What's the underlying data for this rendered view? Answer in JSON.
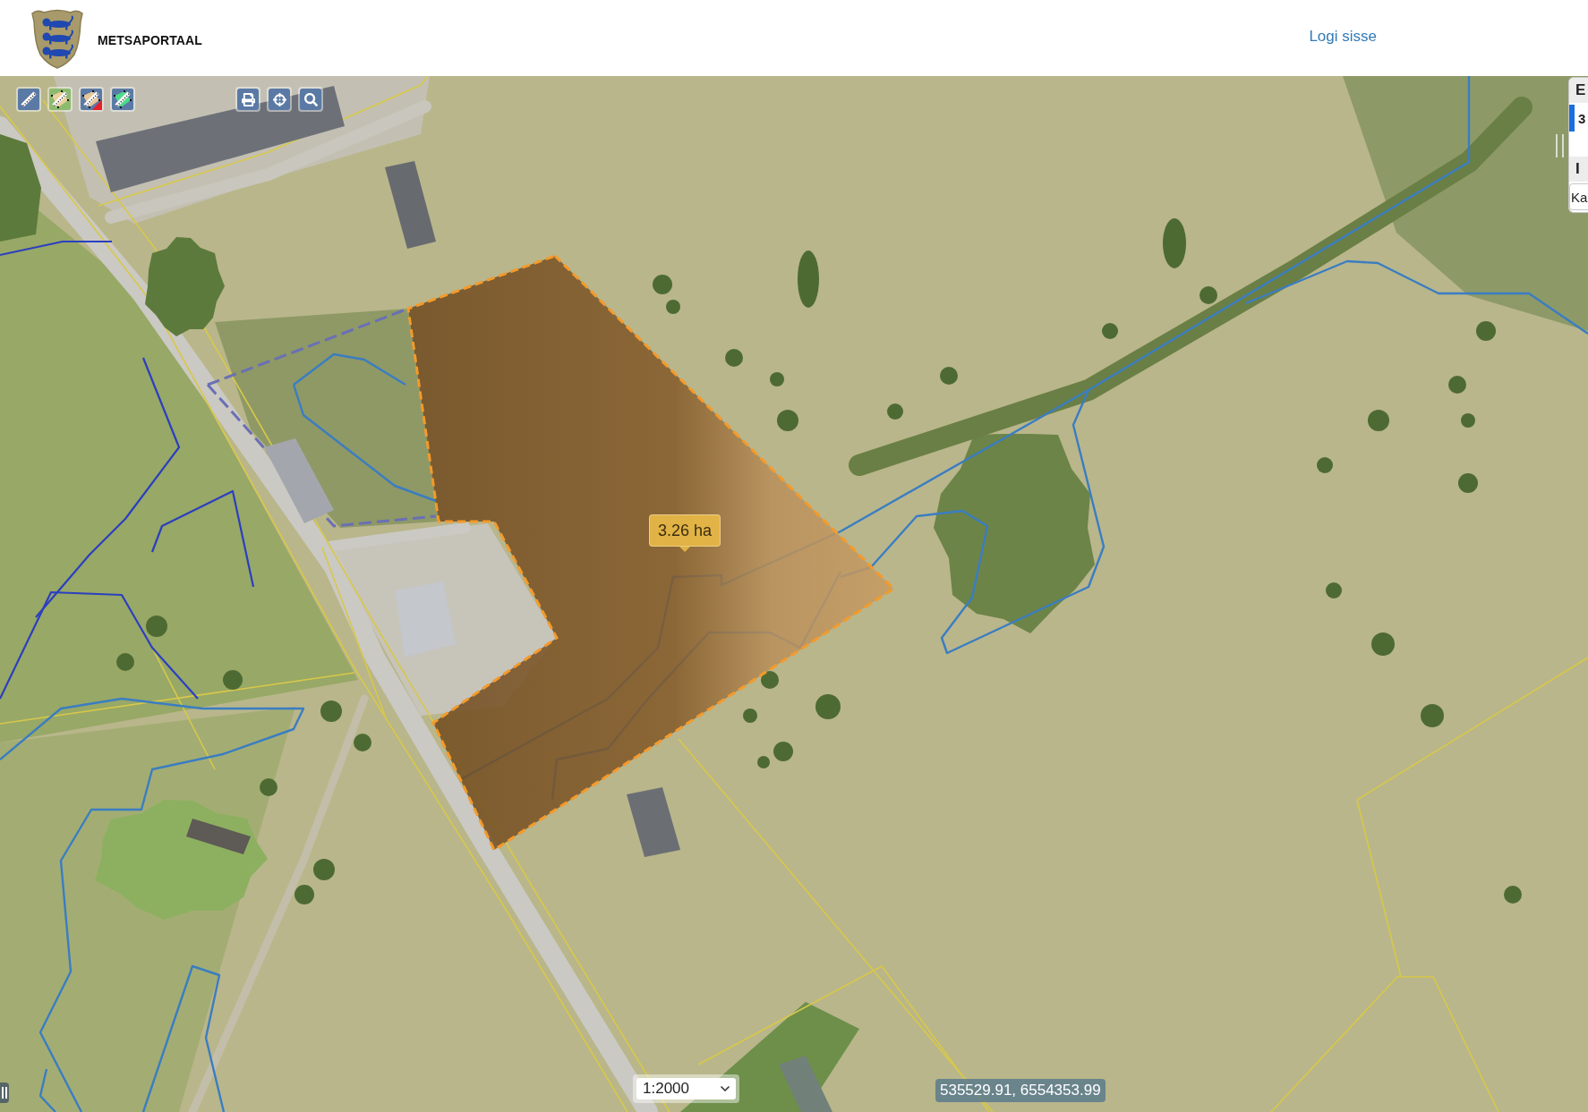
{
  "header": {
    "title": "METSAPORTAAL",
    "login_link": "Logi sisse"
  },
  "map": {
    "measure_tooltip": "3.26 ha",
    "scale_select": {
      "value": "1:2000"
    },
    "mouse_position": "535529.91, 6554353.99"
  },
  "side_panel": {
    "sections": [
      {
        "heading": "E",
        "items": [
          {
            "label": "3",
            "selected": true
          }
        ]
      },
      {
        "heading": "I",
        "items": [
          {
            "label": "Ka",
            "selected": false
          }
        ]
      }
    ]
  }
}
